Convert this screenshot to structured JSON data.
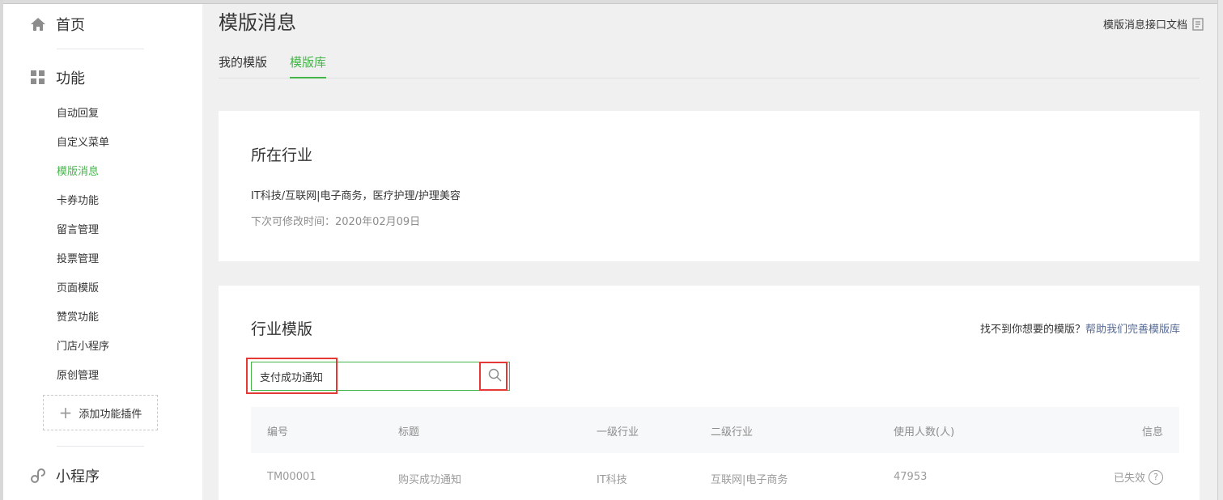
{
  "sidebar": {
    "home": {
      "label": "首页",
      "icon": "home-icon"
    },
    "features": {
      "label": "功能",
      "icon": "grid-icon"
    },
    "items": [
      {
        "label": "自动回复",
        "active": false
      },
      {
        "label": "自定义菜单",
        "active": false
      },
      {
        "label": "模版消息",
        "active": true
      },
      {
        "label": "卡券功能",
        "active": false
      },
      {
        "label": "留言管理",
        "active": false
      },
      {
        "label": "投票管理",
        "active": false
      },
      {
        "label": "页面模版",
        "active": false
      },
      {
        "label": "赞赏功能",
        "active": false
      },
      {
        "label": "门店小程序",
        "active": false
      },
      {
        "label": "原创管理",
        "active": false
      }
    ],
    "add_plugin": "添加功能插件",
    "miniprogram": {
      "label": "小程序",
      "icon": "link-icon"
    }
  },
  "header": {
    "title": "模版消息",
    "doc_link": "模版消息接口文档"
  },
  "tabs": [
    {
      "label": "我的模版",
      "active": false
    },
    {
      "label": "模版库",
      "active": true
    }
  ],
  "industry_card": {
    "title": "所在行业",
    "industries": "IT科技/互联网|电子商务，医疗护理/护理美容",
    "modify_time": "下次可修改时间：2020年02月09日"
  },
  "template_card": {
    "title": "行业模版",
    "help_prefix": "找不到你想要的模版？",
    "help_link": "帮助我们完善模版库",
    "search": {
      "value": "支付成功通知",
      "placeholder": ""
    },
    "columns": [
      "编号",
      "标题",
      "一级行业",
      "二级行业",
      "使用人数(人)",
      "信息"
    ],
    "rows": [
      {
        "id": "TM00001",
        "title": "购买成功通知",
        "industry1": "IT科技",
        "industry2": "互联网|电子商务",
        "users": "47953",
        "info": "已失效"
      }
    ]
  },
  "colors": {
    "accent": "#44b549",
    "link": "#576b95",
    "highlight": "#e53935"
  }
}
